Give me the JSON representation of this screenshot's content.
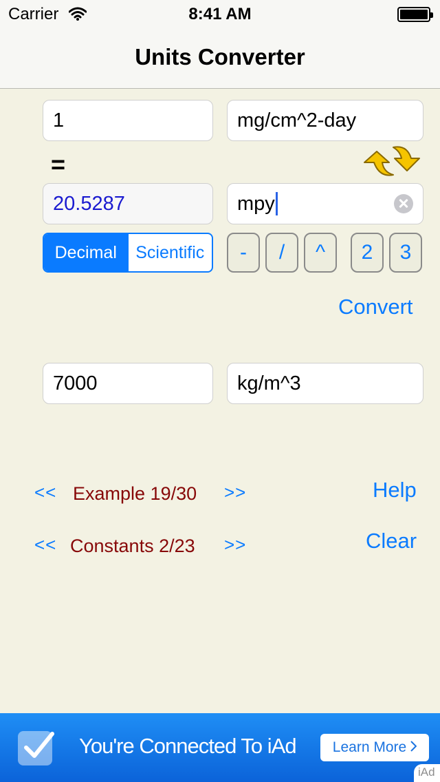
{
  "status_bar": {
    "carrier": "Carrier",
    "time": "8:41 AM",
    "battery_level": 1.0
  },
  "nav": {
    "title": "Units Converter"
  },
  "input": {
    "value": "1",
    "unit": "mg/cm^2-day"
  },
  "equals": "=",
  "output": {
    "value": "20.5287",
    "unit": "mpy"
  },
  "format_mode": {
    "options": [
      "Decimal",
      "Scientific"
    ],
    "selected": "Decimal"
  },
  "keys": [
    "-",
    "/",
    "^",
    "2",
    "3"
  ],
  "convert_label": "Convert",
  "constant_field": {
    "value": "7000",
    "unit": "kg/m^3"
  },
  "examples": {
    "prev": "<<",
    "label": "Example 19/30",
    "next": ">>"
  },
  "constants": {
    "prev": "<<",
    "label": "Constants 2/23",
    "next": ">>"
  },
  "help_label": "Help",
  "clear_label": "Clear",
  "ad": {
    "message": "You're Connected To iAd",
    "button": "Learn More",
    "badge": "iAd"
  },
  "colors": {
    "accent": "#0a7bff",
    "counter_text": "#870808",
    "result_text": "#1a1ad0",
    "background": "#f3f2e3",
    "ad_banner": "#1f8ef5"
  },
  "icons": {
    "status_bar": [
      "wifi-icon",
      "battery-icon"
    ],
    "swap": "swap-arrows-icon",
    "clear": "clear-circle-icon",
    "ad_check": "checkmark-icon",
    "ad_button_chevron": "chevron-right-icon"
  }
}
